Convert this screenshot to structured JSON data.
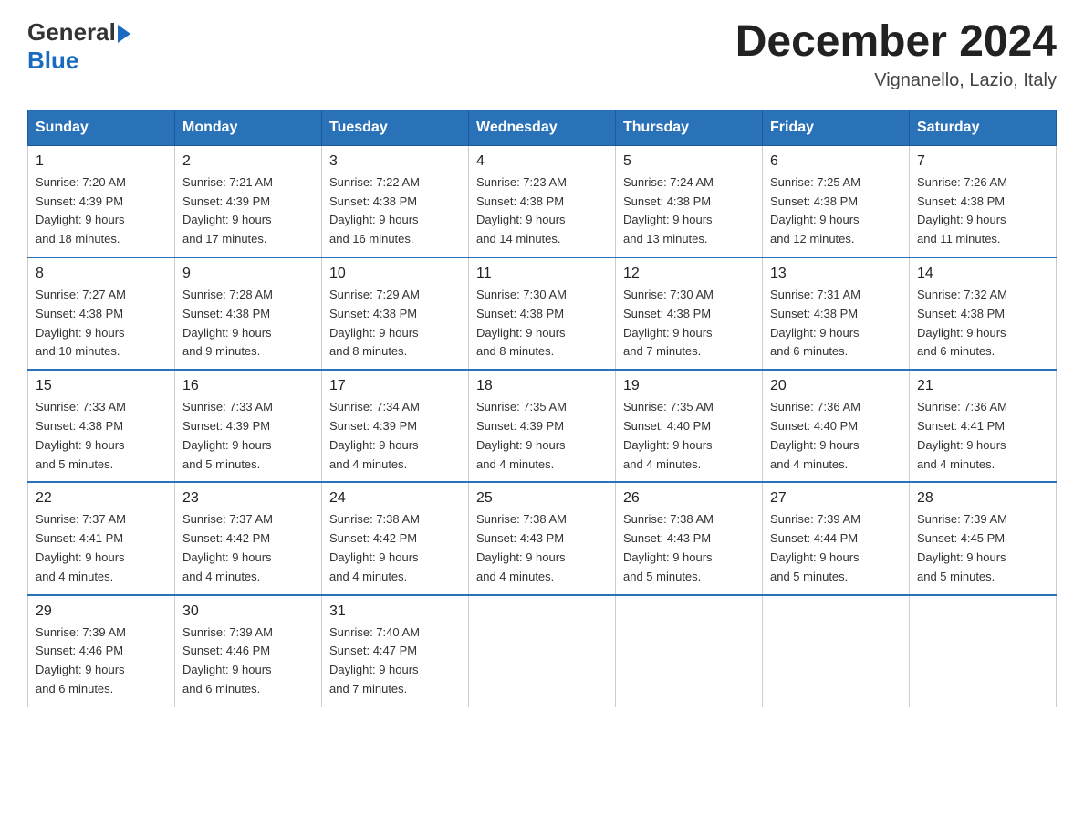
{
  "logo": {
    "general": "General",
    "blue": "Blue"
  },
  "title": "December 2024",
  "location": "Vignanello, Lazio, Italy",
  "days_of_week": [
    "Sunday",
    "Monday",
    "Tuesday",
    "Wednesday",
    "Thursday",
    "Friday",
    "Saturday"
  ],
  "weeks": [
    [
      {
        "day": "1",
        "sunrise": "7:20 AM",
        "sunset": "4:39 PM",
        "daylight": "9 hours and 18 minutes."
      },
      {
        "day": "2",
        "sunrise": "7:21 AM",
        "sunset": "4:39 PM",
        "daylight": "9 hours and 17 minutes."
      },
      {
        "day": "3",
        "sunrise": "7:22 AM",
        "sunset": "4:38 PM",
        "daylight": "9 hours and 16 minutes."
      },
      {
        "day": "4",
        "sunrise": "7:23 AM",
        "sunset": "4:38 PM",
        "daylight": "9 hours and 14 minutes."
      },
      {
        "day": "5",
        "sunrise": "7:24 AM",
        "sunset": "4:38 PM",
        "daylight": "9 hours and 13 minutes."
      },
      {
        "day": "6",
        "sunrise": "7:25 AM",
        "sunset": "4:38 PM",
        "daylight": "9 hours and 12 minutes."
      },
      {
        "day": "7",
        "sunrise": "7:26 AM",
        "sunset": "4:38 PM",
        "daylight": "9 hours and 11 minutes."
      }
    ],
    [
      {
        "day": "8",
        "sunrise": "7:27 AM",
        "sunset": "4:38 PM",
        "daylight": "9 hours and 10 minutes."
      },
      {
        "day": "9",
        "sunrise": "7:28 AM",
        "sunset": "4:38 PM",
        "daylight": "9 hours and 9 minutes."
      },
      {
        "day": "10",
        "sunrise": "7:29 AM",
        "sunset": "4:38 PM",
        "daylight": "9 hours and 8 minutes."
      },
      {
        "day": "11",
        "sunrise": "7:30 AM",
        "sunset": "4:38 PM",
        "daylight": "9 hours and 8 minutes."
      },
      {
        "day": "12",
        "sunrise": "7:30 AM",
        "sunset": "4:38 PM",
        "daylight": "9 hours and 7 minutes."
      },
      {
        "day": "13",
        "sunrise": "7:31 AM",
        "sunset": "4:38 PM",
        "daylight": "9 hours and 6 minutes."
      },
      {
        "day": "14",
        "sunrise": "7:32 AM",
        "sunset": "4:38 PM",
        "daylight": "9 hours and 6 minutes."
      }
    ],
    [
      {
        "day": "15",
        "sunrise": "7:33 AM",
        "sunset": "4:38 PM",
        "daylight": "9 hours and 5 minutes."
      },
      {
        "day": "16",
        "sunrise": "7:33 AM",
        "sunset": "4:39 PM",
        "daylight": "9 hours and 5 minutes."
      },
      {
        "day": "17",
        "sunrise": "7:34 AM",
        "sunset": "4:39 PM",
        "daylight": "9 hours and 4 minutes."
      },
      {
        "day": "18",
        "sunrise": "7:35 AM",
        "sunset": "4:39 PM",
        "daylight": "9 hours and 4 minutes."
      },
      {
        "day": "19",
        "sunrise": "7:35 AM",
        "sunset": "4:40 PM",
        "daylight": "9 hours and 4 minutes."
      },
      {
        "day": "20",
        "sunrise": "7:36 AM",
        "sunset": "4:40 PM",
        "daylight": "9 hours and 4 minutes."
      },
      {
        "day": "21",
        "sunrise": "7:36 AM",
        "sunset": "4:41 PM",
        "daylight": "9 hours and 4 minutes."
      }
    ],
    [
      {
        "day": "22",
        "sunrise": "7:37 AM",
        "sunset": "4:41 PM",
        "daylight": "9 hours and 4 minutes."
      },
      {
        "day": "23",
        "sunrise": "7:37 AM",
        "sunset": "4:42 PM",
        "daylight": "9 hours and 4 minutes."
      },
      {
        "day": "24",
        "sunrise": "7:38 AM",
        "sunset": "4:42 PM",
        "daylight": "9 hours and 4 minutes."
      },
      {
        "day": "25",
        "sunrise": "7:38 AM",
        "sunset": "4:43 PM",
        "daylight": "9 hours and 4 minutes."
      },
      {
        "day": "26",
        "sunrise": "7:38 AM",
        "sunset": "4:43 PM",
        "daylight": "9 hours and 5 minutes."
      },
      {
        "day": "27",
        "sunrise": "7:39 AM",
        "sunset": "4:44 PM",
        "daylight": "9 hours and 5 minutes."
      },
      {
        "day": "28",
        "sunrise": "7:39 AM",
        "sunset": "4:45 PM",
        "daylight": "9 hours and 5 minutes."
      }
    ],
    [
      {
        "day": "29",
        "sunrise": "7:39 AM",
        "sunset": "4:46 PM",
        "daylight": "9 hours and 6 minutes."
      },
      {
        "day": "30",
        "sunrise": "7:39 AM",
        "sunset": "4:46 PM",
        "daylight": "9 hours and 6 minutes."
      },
      {
        "day": "31",
        "sunrise": "7:40 AM",
        "sunset": "4:47 PM",
        "daylight": "9 hours and 7 minutes."
      },
      null,
      null,
      null,
      null
    ]
  ],
  "labels": {
    "sunrise": "Sunrise:",
    "sunset": "Sunset:",
    "daylight": "Daylight:"
  }
}
